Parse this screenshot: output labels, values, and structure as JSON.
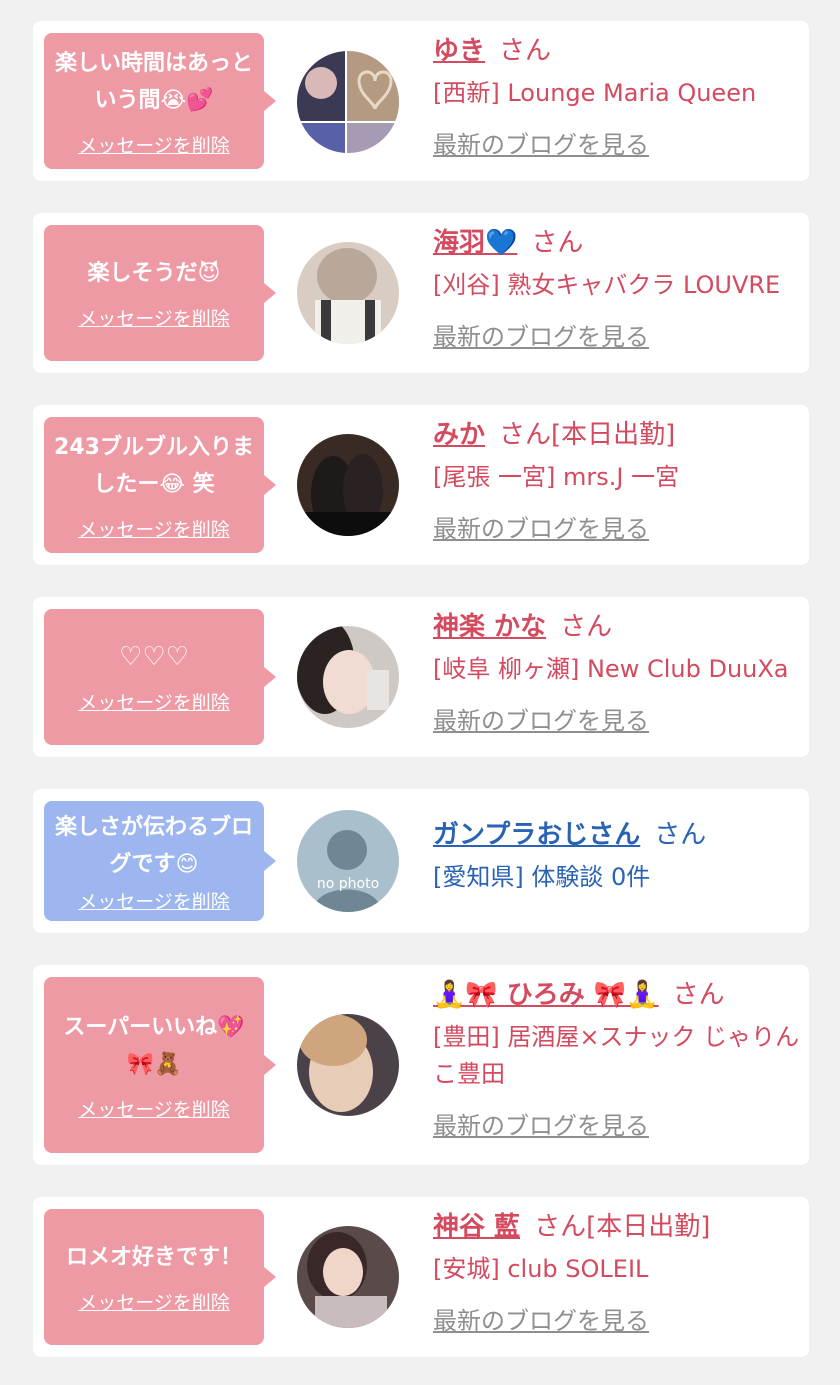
{
  "cards": [
    {
      "bubble_text": "楽しい時間はあっという間😭💕",
      "delete_label": "メッセージを削除",
      "name": "ゆき",
      "san_label": "さん",
      "shop": "[西新] Lounge Maria Queen",
      "blog_label": "最新のブログを見る"
    },
    {
      "bubble_text": "楽しそうだ😈",
      "delete_label": "メッセージを削除",
      "name": "海羽💙",
      "san_label": "さん",
      "shop": "[刈谷] 熟女キャバクラ LOUVRE",
      "blog_label": "最新のブログを見る"
    },
    {
      "bubble_text": "243ブルブル入りましたー😂 笑",
      "delete_label": "メッセージを削除",
      "name": "みか",
      "san_label": "さん[本日出勤]",
      "shop": "[尾張 一宮] mrs.J 一宮",
      "blog_label": "最新のブログを見る"
    },
    {
      "bubble_text": "♡♡♡",
      "delete_label": "メッセージを削除",
      "name": "神楽 かな",
      "san_label": "さん",
      "shop": "[岐阜 柳ヶ瀬] New Club DuuXa",
      "blog_label": "最新のブログを見る"
    },
    {
      "bubble_text": "楽しさが伝わるブログです😊",
      "delete_label": "メッセージを削除",
      "name": "ガンプラおじさん",
      "san_label": "さん",
      "shop": "[愛知県] 体験談 0件",
      "avatar_text": "no photo"
    },
    {
      "bubble_text": "スーパーいいね💖🎀🧸",
      "delete_label": "メッセージを削除",
      "name": "🧘‍♀️🎀 ひろみ 🎀🧘‍♀️",
      "san_label": "さん",
      "shop": "[豊田] 居酒屋×スナック じゃりんこ豊田",
      "blog_label": "最新のブログを見る"
    },
    {
      "bubble_text": "ロメオ好きです！",
      "delete_label": "メッセージを削除",
      "name": "神谷 藍",
      "san_label": "さん[本日出勤]",
      "shop": "[安城] club SOLEIL",
      "blog_label": "最新のブログを見る"
    }
  ],
  "colors": {
    "background": "#f0f0f0",
    "card": "#ffffff",
    "pink_bubble": "#ee9aa4",
    "blue_bubble": "#9db6ef",
    "pink_text": "#d44a5f",
    "blue_text": "#2a63b5",
    "grey_link": "#8f8f8f"
  }
}
